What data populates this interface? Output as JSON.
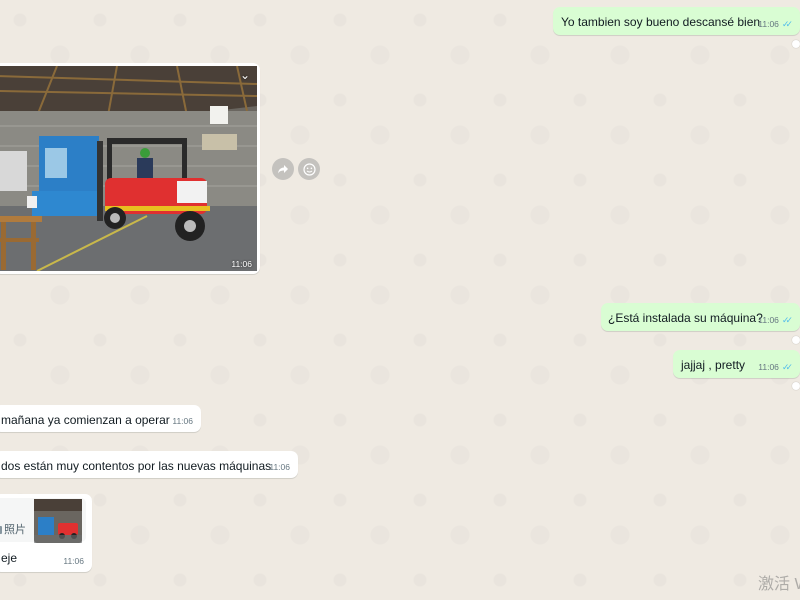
{
  "messages": {
    "m1": {
      "text": "Yo tambien soy bueno descansé bien",
      "time": "11:06"
    },
    "m2": {
      "time": "11:06"
    },
    "m3": {
      "text": "¿Está instalada su máquina?",
      "time": "11:06"
    },
    "m4": {
      "text": "jajjaj  ,  pretty",
      "time": "11:06"
    },
    "m5": {
      "text": "mañana ya comienzan a operar",
      "time": "11:06"
    },
    "m6": {
      "text": "dos están muy contentos por las nuevas máquinas",
      "time": "11:06"
    },
    "m7": {
      "shared_label": "照片",
      "text": "eje",
      "time": "11:06"
    }
  },
  "icons": {
    "read_ticks": "double-check-icon",
    "forward": "forward-arrow-icon",
    "react": "smiley-icon",
    "menu": "chevron-down-icon",
    "shared_type": "photo-icon"
  },
  "watermark": {
    "text": "激活 W"
  },
  "colors": {
    "background": "#efeae2",
    "outgoing": "#d9fdd3",
    "incoming": "#ffffff",
    "read_ticks": "#53bdeb"
  }
}
